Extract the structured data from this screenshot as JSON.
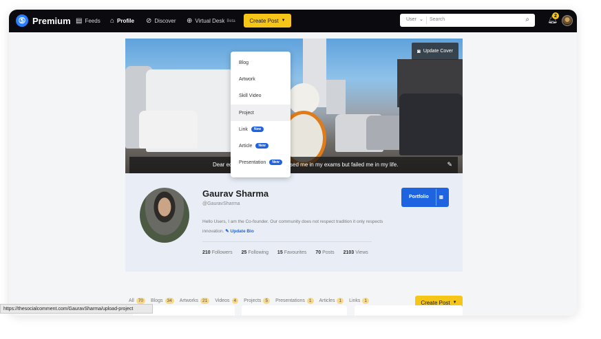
{
  "brand": {
    "logo_glyph": "⑤",
    "name": "Premium"
  },
  "nav": {
    "feeds": "Feeds",
    "profile": "Profile",
    "discover": "Discover",
    "virtual_desk": "Virtual Desk",
    "virtual_desk_badge": "Beta",
    "create_post": "Create Post"
  },
  "search": {
    "scope": "User",
    "placeholder": "Search"
  },
  "notifications": {
    "count": "2"
  },
  "create_menu": {
    "items": [
      {
        "label": "Blog"
      },
      {
        "label": "Artwork"
      },
      {
        "label": "Skill Video"
      },
      {
        "label": "Project"
      },
      {
        "label": "Link",
        "badge": "New"
      },
      {
        "label": "Article",
        "badge": "New"
      },
      {
        "label": "Presentation",
        "badge": "New"
      }
    ]
  },
  "cover": {
    "update_label": "Update Cover",
    "quote": "Dear education system you passed me in my exams but failed me in my life."
  },
  "profile": {
    "name": "Gaurav Sharma",
    "handle": "@GauravSharma",
    "bio": "Hello Users, I am the Co-founder. Our community does not respect tradition it only respects innovation.",
    "update_bio": "Update Bio",
    "portfolio_label": "Portfolio",
    "stats": [
      {
        "value": "210",
        "label": "Followers"
      },
      {
        "value": "25",
        "label": "Following"
      },
      {
        "value": "15",
        "label": "Favourites"
      },
      {
        "value": "70",
        "label": "Posts"
      },
      {
        "value": "2103",
        "label": "Views"
      }
    ]
  },
  "filters": [
    {
      "label": "All",
      "count": "70"
    },
    {
      "label": "Blogs",
      "count": "34"
    },
    {
      "label": "Artworks",
      "count": "21"
    },
    {
      "label": "Videos",
      "count": "4"
    },
    {
      "label": "Projects",
      "count": "5"
    },
    {
      "label": "Presentations",
      "count": "1"
    },
    {
      "label": "Articles",
      "count": "1"
    },
    {
      "label": "Links",
      "count": "1"
    }
  ],
  "create_post_bottom": "Create Post",
  "status_url": "https://thesocialcomment.com/GauravSharma/upload-project",
  "colors": {
    "accent_yellow": "#f5c518",
    "accent_blue": "#1e63e0",
    "topbar": "#0a0a0f"
  }
}
